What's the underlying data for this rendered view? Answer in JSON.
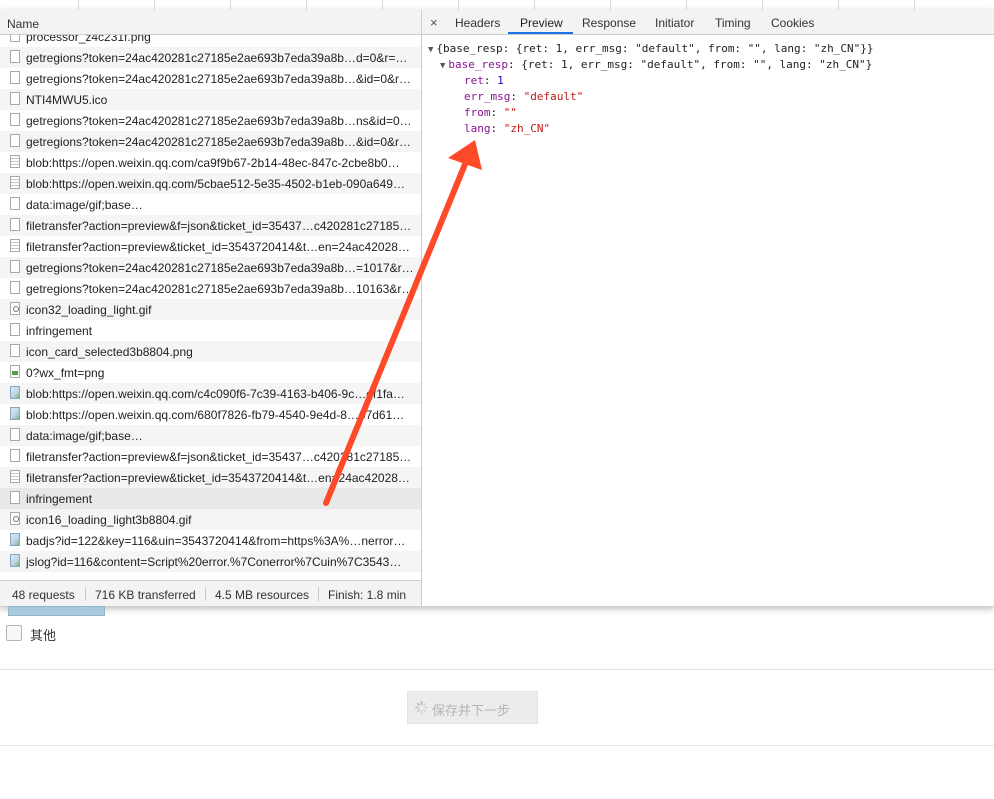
{
  "network": {
    "column_header": "Name",
    "requests": [
      {
        "name": "processor_z4c231f.png",
        "icon": "file-icon"
      },
      {
        "name": "getregions?token=24ac420281c27185e2ae693b7eda39a8b…d=0&r=…",
        "icon": "file-icon"
      },
      {
        "name": "getregions?token=24ac420281c27185e2ae693b7eda39a8b…&id=0&r…",
        "icon": "file-icon"
      },
      {
        "name": "NTI4MWU5.ico",
        "icon": "file-icon"
      },
      {
        "name": "getregions?token=24ac420281c27185e2ae693b7eda39a8b…ns&id=0…",
        "icon": "file-icon"
      },
      {
        "name": "getregions?token=24ac420281c27185e2ae693b7eda39a8b…&id=0&r…",
        "icon": "file-icon"
      },
      {
        "name": "blob:https://open.weixin.qq.com/ca9f9b67-2b14-48ec-847c-2cbe8b0…",
        "icon": "document-icon"
      },
      {
        "name": "blob:https://open.weixin.qq.com/5cbae512-5e35-4502-b1eb-090a649…",
        "icon": "document-icon"
      },
      {
        "name": "data:image/gif;base…",
        "icon": "file-icon"
      },
      {
        "name": "filetransfer?action=preview&f=json&ticket_id=35437…c420281c27185…",
        "icon": "file-icon"
      },
      {
        "name": "filetransfer?action=preview&ticket_id=3543720414&t…en=24ac42028…",
        "icon": "document-icon"
      },
      {
        "name": "getregions?token=24ac420281c27185e2ae693b7eda39a8b…=1017&r…",
        "icon": "file-icon"
      },
      {
        "name": "getregions?token=24ac420281c27185e2ae693b7eda39a8b…10163&r…",
        "icon": "file-icon"
      },
      {
        "name": "icon32_loading_light.gif",
        "icon": "gif-icon"
      },
      {
        "name": "infringement",
        "icon": "file-icon"
      },
      {
        "name": "icon_card_selected3b8804.png",
        "icon": "file-icon"
      },
      {
        "name": "0?wx_fmt=png",
        "icon": "image-green-icon"
      },
      {
        "name": "blob:https://open.weixin.qq.com/c4c090f6-7c39-4163-b406-9c…ef1fa…",
        "icon": "image-icon"
      },
      {
        "name": "blob:https://open.weixin.qq.com/680f7826-fb79-4540-9e4d-8…67d61…",
        "icon": "image-icon"
      },
      {
        "name": "data:image/gif;base…",
        "icon": "file-icon"
      },
      {
        "name": "filetransfer?action=preview&f=json&ticket_id=35437…c420281c27185…",
        "icon": "file-icon"
      },
      {
        "name": "filetransfer?action=preview&ticket_id=3543720414&t…en=24ac42028…",
        "icon": "document-icon"
      },
      {
        "name": "infringement",
        "icon": "file-icon"
      },
      {
        "name": "icon16_loading_light3b8804.gif",
        "icon": "gif-icon"
      },
      {
        "name": "badjs?id=122&key=116&uin=3543720414&from=https%3A%…nerror…",
        "icon": "image-icon"
      },
      {
        "name": "jslog?id=116&content=Script%20error.%7Conerror%7Cuin%7C3543…",
        "icon": "image-icon"
      }
    ],
    "status": {
      "requests": "48 requests",
      "transferred": "716 KB transferred",
      "resources": "4.5 MB resources",
      "finish": "Finish: 1.8 min"
    }
  },
  "details": {
    "close_icon": "×",
    "tabs": [
      "Headers",
      "Preview",
      "Response",
      "Initiator",
      "Timing",
      "Cookies"
    ],
    "active_tab": "Preview",
    "preview": {
      "root_summary": "{base_resp: {ret: 1, err_msg: \"default\", from: \"\", lang: \"zh_CN\"}}",
      "base_resp_key": "base_resp",
      "base_resp_summary": "{ret: 1, err_msg: \"default\", from: \"\", lang: \"zh_CN\"}",
      "fields": [
        {
          "key": "ret",
          "value": "1",
          "type": "number"
        },
        {
          "key": "err_msg",
          "value": "\"default\"",
          "type": "string"
        },
        {
          "key": "from",
          "value": "\"\"",
          "type": "string"
        },
        {
          "key": "lang",
          "value": "\"zh_CN\"",
          "type": "string"
        }
      ]
    }
  },
  "page": {
    "checkbox_label": "其他",
    "submit_button": "保存并下一步"
  },
  "colors": {
    "annotation_arrow": "#ff4a2a",
    "active_tab_underline": "#1a73e8",
    "json_key": "#881391",
    "json_string": "#c41a16"
  }
}
